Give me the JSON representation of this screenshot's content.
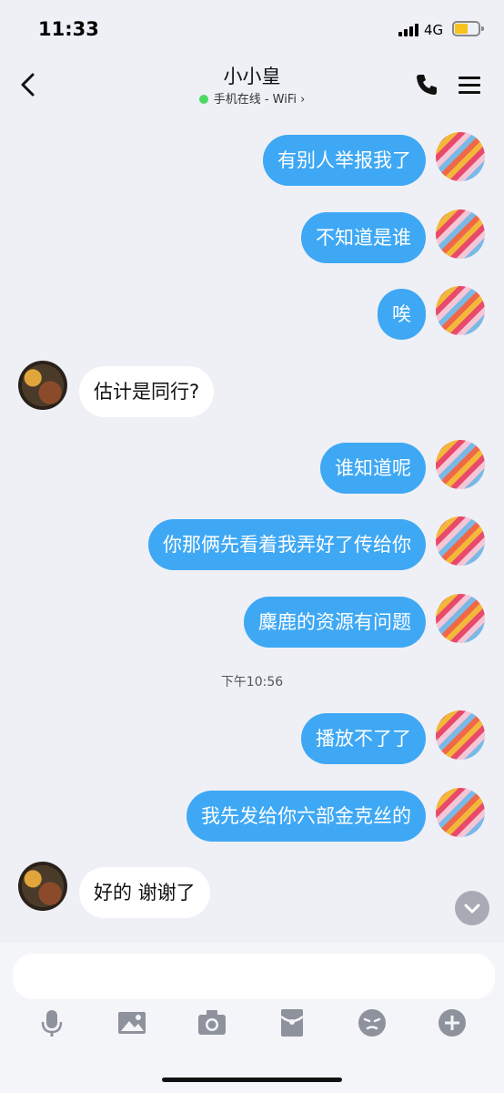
{
  "status_bar": {
    "time": "11:33",
    "network": "4G"
  },
  "header": {
    "title": "小小皇",
    "status": "手机在线 - WiFi",
    "status_arrow": "›"
  },
  "messages": [
    {
      "side": "right",
      "text": "有别人举报我了"
    },
    {
      "side": "right",
      "text": "不知道是谁"
    },
    {
      "side": "right",
      "text": "唉"
    },
    {
      "side": "left",
      "text": "估计是同行?"
    },
    {
      "side": "right",
      "text": "谁知道呢"
    },
    {
      "side": "right",
      "text": "你那俩先看着我弄好了传给你"
    },
    {
      "side": "right",
      "text": "麋鹿的资源有问题"
    },
    {
      "side": "right",
      "text": "播放不了了"
    },
    {
      "side": "right",
      "text": "我先发给你六部金克丝的"
    },
    {
      "side": "left",
      "text": "好的 谢谢了"
    }
  ],
  "timestamp": "下午10:56",
  "input": {
    "value": "",
    "placeholder": ""
  },
  "toolbar_icons": [
    "microphone-icon",
    "image-icon",
    "camera-icon",
    "red-packet-icon",
    "emoji-icon",
    "plus-icon"
  ],
  "colors": {
    "bubble_self": "#3fa8f4",
    "bubble_other": "#ffffff",
    "background": "#eef0f6",
    "online": "#4cd964"
  }
}
